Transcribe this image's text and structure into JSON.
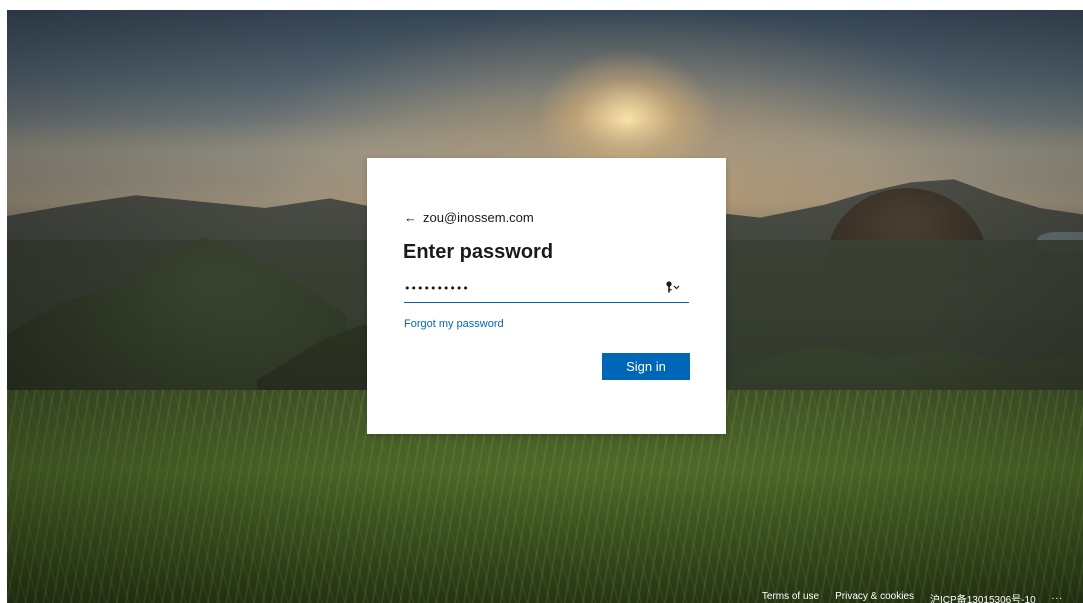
{
  "account": {
    "back_arrow": "←",
    "email": "zou@inossem.com"
  },
  "heading": "Enter password",
  "password_field": {
    "value": "••••••••••",
    "icon": "key-icon"
  },
  "forgot_link": "Forgot my password",
  "signin_button": "Sign in",
  "footer": {
    "terms": "Terms of use",
    "privacy": "Privacy & cookies",
    "icp": "沪ICP备13015306号-10",
    "more": "..."
  },
  "colors": {
    "accent": "#0067b8",
    "text": "#1b1b1b",
    "card": "#ffffff"
  }
}
